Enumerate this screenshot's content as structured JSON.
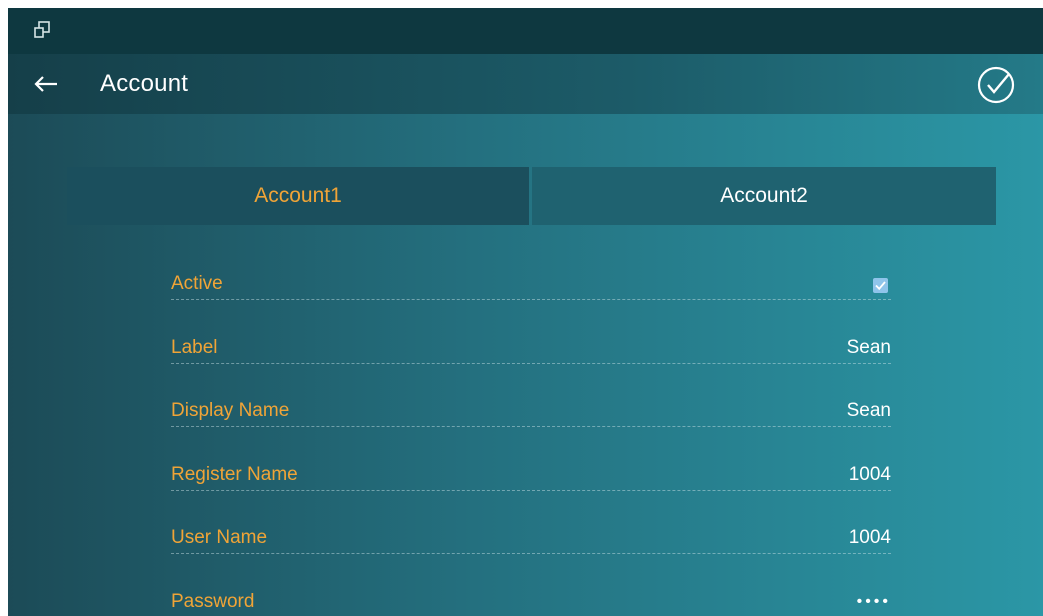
{
  "status_bar": {
    "icon": "window-restore-icon"
  },
  "app_bar": {
    "back_icon": "arrow-left-icon",
    "title": "Account",
    "confirm_icon": "check-circle-icon"
  },
  "tabs": [
    {
      "label": "Account1",
      "selected": true
    },
    {
      "label": "Account2",
      "selected": false
    }
  ],
  "fields": {
    "active": {
      "label": "Active",
      "checked": true
    },
    "label": {
      "label": "Label",
      "value": "Sean"
    },
    "display_name": {
      "label": "Display Name",
      "value": "Sean"
    },
    "register_name": {
      "label": "Register Name",
      "value": "1004"
    },
    "user_name": {
      "label": "User Name",
      "value": "1004"
    },
    "password": {
      "label": "Password",
      "value": "••••"
    }
  },
  "colors": {
    "accent": "#f0a437",
    "text": "#ffffff",
    "status_bar": "#0e3840",
    "checkbox": "#8fc4ea"
  }
}
